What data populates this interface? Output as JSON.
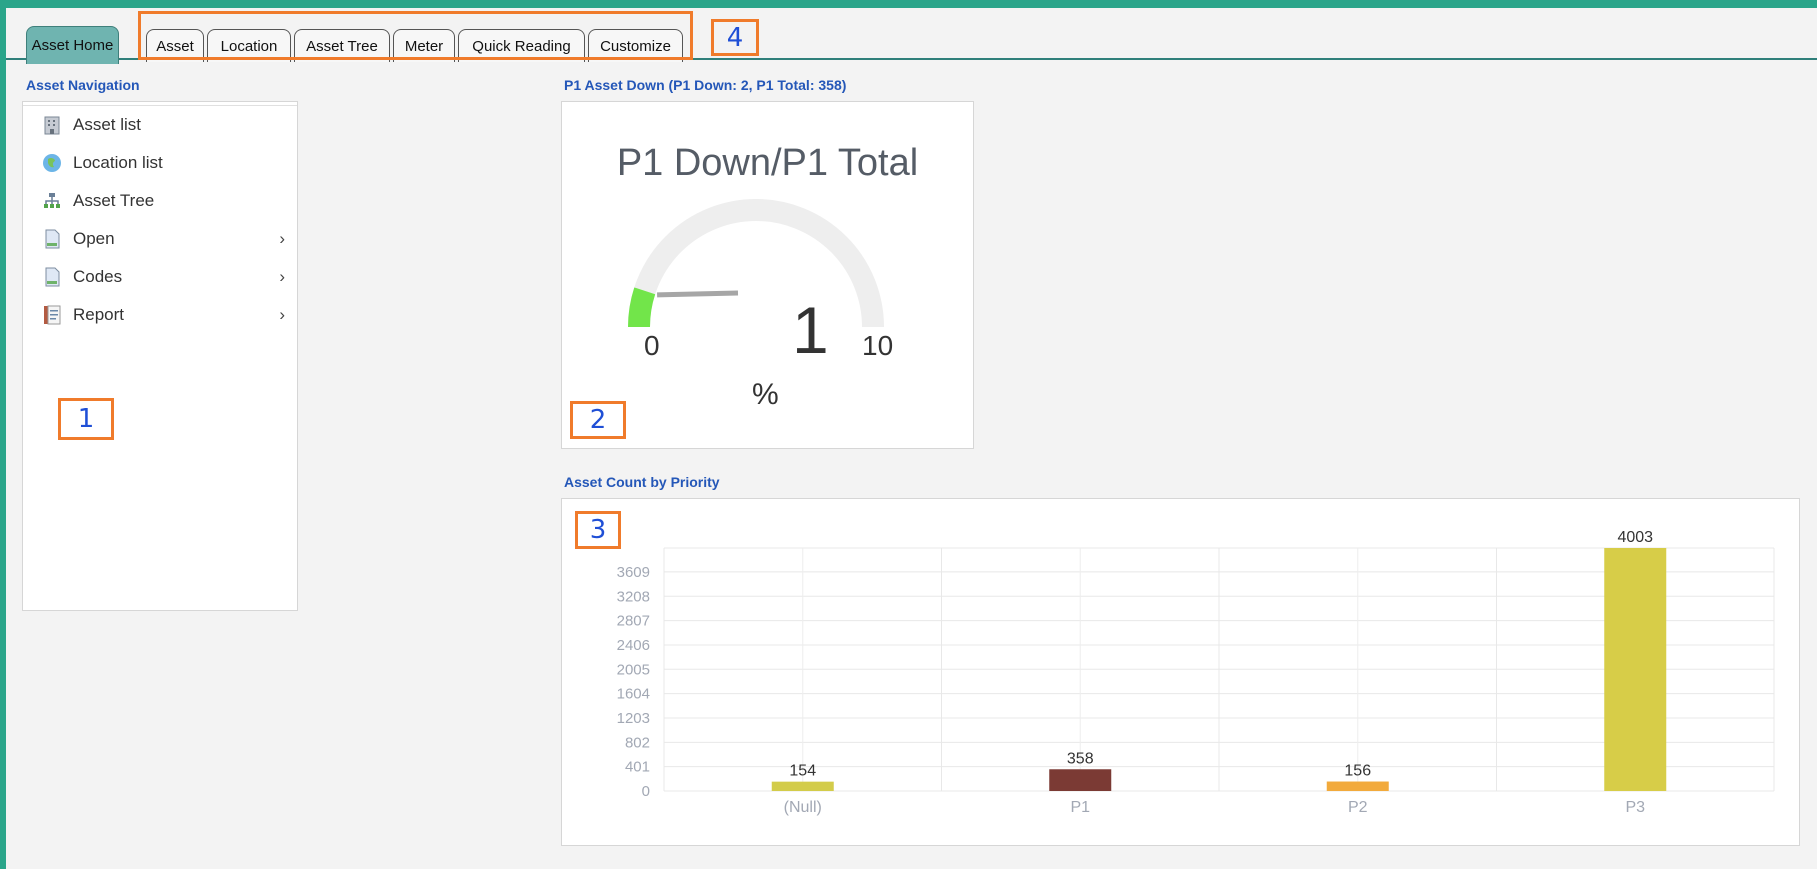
{
  "tabs": [
    {
      "label": "Asset Home"
    },
    {
      "label": "Asset"
    },
    {
      "label": "Location"
    },
    {
      "label": "Asset Tree"
    },
    {
      "label": "Meter"
    },
    {
      "label": "Quick Reading"
    },
    {
      "label": "Customize"
    }
  ],
  "callouts": [
    "1",
    "2",
    "3",
    "4"
  ],
  "navigation": {
    "title": "Asset Navigation",
    "items": [
      {
        "label": "Asset list",
        "icon": "building-icon"
      },
      {
        "label": "Location list",
        "icon": "globe-icon"
      },
      {
        "label": "Asset Tree",
        "icon": "hierarchy-icon"
      },
      {
        "label": "Open",
        "icon": "document-icon",
        "arrow": "›"
      },
      {
        "label": "Codes",
        "icon": "document-icon",
        "arrow": "›"
      },
      {
        "label": "Report",
        "icon": "report-icon",
        "arrow": "›"
      }
    ]
  },
  "gauge": {
    "section_title": "P1 Asset Down (P1 Down: 2, P1 Total: 358)",
    "title": "P1 Down/P1 Total",
    "value": "1",
    "min": "0",
    "max": "10",
    "unit": "%"
  },
  "chart_section": {
    "title": "Asset Count by Priority"
  },
  "chart_data": {
    "type": "bar",
    "categories": [
      "(Null)",
      "P1",
      "P2",
      "P3"
    ],
    "values": [
      154,
      358,
      156,
      4003
    ],
    "colors": [
      "#d3cc4a",
      "#7b3a34",
      "#f2aa3c",
      "#d7cd48"
    ],
    "yticks": [
      0,
      401,
      802,
      1203,
      1604,
      2005,
      2406,
      2807,
      3208,
      3609
    ],
    "ylim": [
      0,
      4003
    ],
    "grid": true
  }
}
